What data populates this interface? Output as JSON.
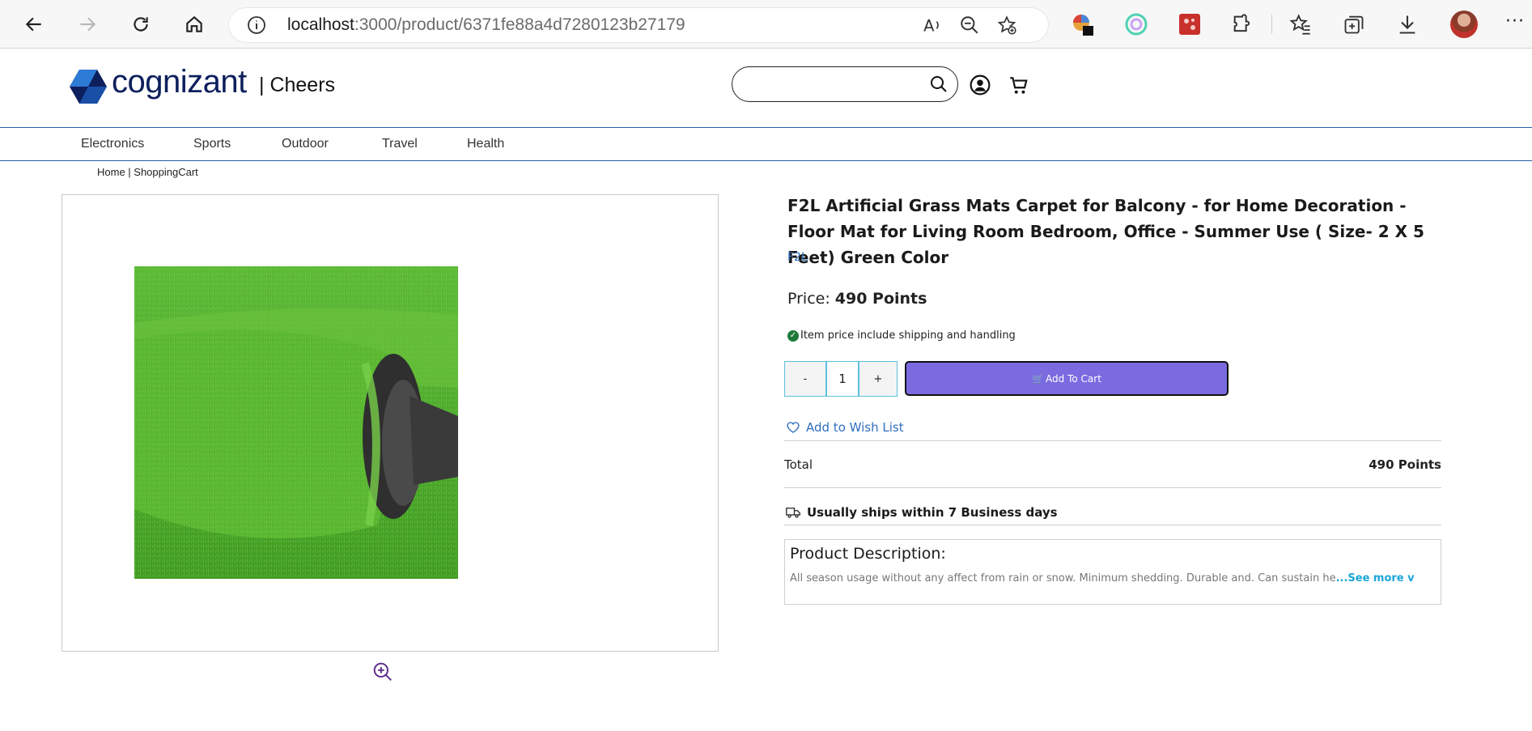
{
  "browser": {
    "url_host": "localhost",
    "url_path": ":3000/product/6371fe88a4d7280123b27179",
    "icons": [
      "back-icon",
      "forward-icon",
      "refresh-icon",
      "home-icon",
      "site-info-icon",
      "read-aloud-icon",
      "zoom-out-icon",
      "add-favorite-icon",
      "extension-color-icon",
      "extension-circle-icon",
      "extension-red-icon",
      "extensions-icon",
      "favorites-icon",
      "collections-icon",
      "downloads-icon",
      "profile-avatar",
      "more-menu-icon"
    ],
    "more_label": "···"
  },
  "header": {
    "logo_text": "cognizant",
    "brand_label": "| Cheers",
    "search": {
      "placeholder": "",
      "value": ""
    },
    "colors": {
      "logo_navy": "#0d1f5c",
      "logo_blue": "#2e7bd6",
      "divider_blue": "#1f5fa8"
    }
  },
  "categories": [
    "Electronics",
    "Sports",
    "Outdoor",
    "Travel",
    "Health"
  ],
  "breadcrumb": "Home | ShoppingCart",
  "product": {
    "title": "F2L Artificial Grass Mats Carpet for Balcony - for Home Decoration - Floor Mat for Living Room Bedroom, Office - Summer Use ( Size- 2 X 5 Feet) Green Color",
    "brand": "F2L",
    "price_label": "Price:",
    "price_value": "490 Points",
    "shipping_note": "Item price include shipping and handling",
    "quantity": {
      "minus": "-",
      "value": "1",
      "plus": "+"
    },
    "add_to_cart": "Add To Cart",
    "wishlist": "Add to Wish List",
    "total_label": "Total",
    "total_value": "490 Points",
    "ships_text": "Usually ships within 7 Business days",
    "description_title": "Product Description:",
    "description_text": "All season usage without any affect from rain or snow. Minimum shedding. Durable and. Can sustain he",
    "see_more": "...See more v",
    "colors": {
      "button": "#7b6be0",
      "link": "#2f6fbf",
      "check": "#1e7a3a",
      "see_more": "#1aa6d8"
    }
  }
}
